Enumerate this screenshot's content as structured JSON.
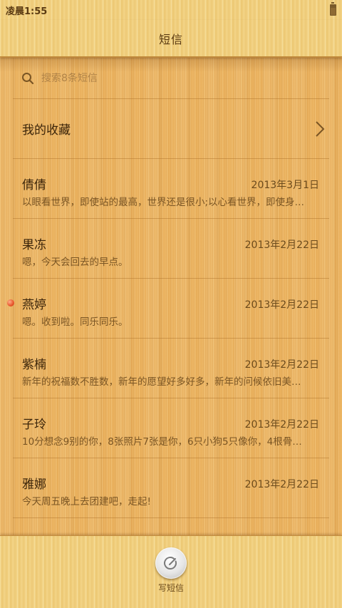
{
  "status_bar": {
    "time": "凌晨1:55"
  },
  "header": {
    "title": "短信"
  },
  "search": {
    "placeholder": "搜索8条短信"
  },
  "favorites": {
    "label": "我的收藏"
  },
  "messages": [
    {
      "name": "倩倩",
      "date": "2013年3月1日",
      "preview": "以眼看世界，即使站的最高，世界还是很小;以心看世界，即使身…",
      "unread": false
    },
    {
      "name": "果冻",
      "date": "2013年2月22日",
      "preview": "嗯，今天会回去的早点。",
      "unread": false
    },
    {
      "name": "燕婷",
      "date": "2013年2月22日",
      "preview": "嗯。收到啦。同乐同乐。",
      "unread": true
    },
    {
      "name": "紫楠",
      "date": "2013年2月22日",
      "preview": "新年的祝福数不胜数，新年的愿望好多好多，新年的问候依旧美…",
      "unread": false
    },
    {
      "name": "子玲",
      "date": "2013年2月22日",
      "preview": "10分想念9别的你，8张照片7张是你，6只小狗5只像你，4根骨…",
      "unread": false
    },
    {
      "name": "雅娜",
      "date": "2013年2月22日",
      "preview": "今天周五晚上去团建吧，走起!",
      "unread": false
    }
  ],
  "bottom_bar": {
    "compose_label": "写短信"
  },
  "colors": {
    "wood": "#ebb25e",
    "text_dark": "#3c250a",
    "unread_dot": "#e8542a"
  }
}
